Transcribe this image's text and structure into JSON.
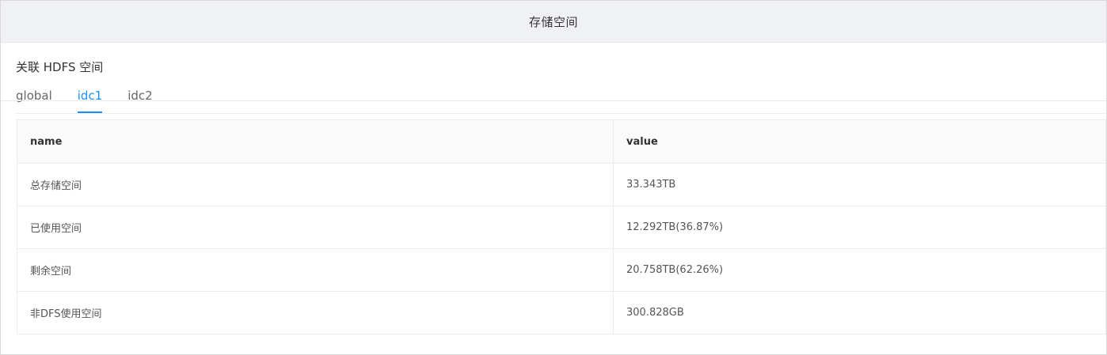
{
  "card": {
    "title": "存储空间"
  },
  "section": {
    "title": "关联 HDFS 空间"
  },
  "tabs": [
    {
      "label": "global",
      "active": false
    },
    {
      "label": "idc1",
      "active": true
    },
    {
      "label": "idc2",
      "active": false
    }
  ],
  "table": {
    "headers": {
      "name": "name",
      "value": "value"
    },
    "rows": [
      {
        "name": "总存储空间",
        "value": "33.343TB"
      },
      {
        "name": "已使用空间",
        "value": "12.292TB(36.87%)"
      },
      {
        "name": "剩余空间",
        "value": "20.758TB(62.26%)"
      },
      {
        "name": "非DFS使用空间",
        "value": "300.828GB"
      }
    ]
  },
  "colors": {
    "accent": "#1890ff",
    "header_bg": "#f0f1f5",
    "table_header_bg": "#fafafa"
  }
}
